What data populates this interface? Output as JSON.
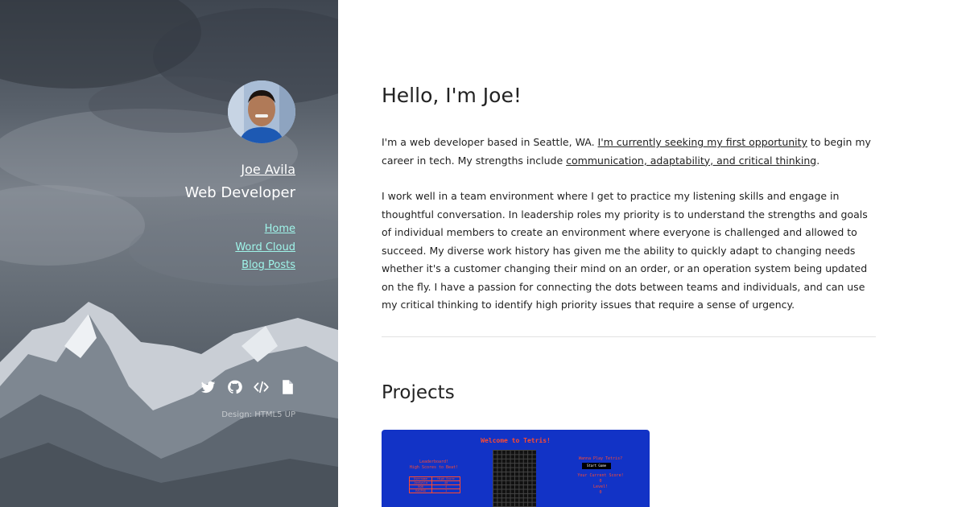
{
  "sidebar": {
    "name": "Joe Avila",
    "role": "Web Developer",
    "nav": [
      {
        "label": "Home"
      },
      {
        "label": "Word Cloud"
      },
      {
        "label": "Blog Posts"
      }
    ],
    "social": [
      {
        "icon": "twitter-icon"
      },
      {
        "icon": "github-icon"
      },
      {
        "icon": "code-icon"
      },
      {
        "icon": "document-icon"
      }
    ],
    "credit": "Design: HTML5 UP",
    "accent": "#9ff5ea"
  },
  "main": {
    "greeting": "Hello, I'm Joe!",
    "intro": {
      "text1": "I'm a web developer based in Seattle, WA. ",
      "link1": "I'm currently seeking my first opportunity",
      "text2": " to begin my career in tech. My strengths include ",
      "link2": "communication, adaptability, and critical thinking",
      "text3": "."
    },
    "bio": "I work well in a team environment where I get to practice my listening skills and engage in thoughtful conversation. In leadership roles my priority is to understand the strengths and goals of individual members to create an environment where everyone is challenged and allowed to succeed. My diverse work history has given me the ability to quickly adapt to changing needs whether it's a customer changing their mind on an order, or an operation system being updated on the fly. I have a passion for connecting the dots between teams and individuals, and can use my critical thinking to identify high priority issues that require a sense of urgency.",
    "projects_heading": "Projects",
    "project": {
      "title": "Welcome to Tetris!",
      "leaderboard_title": "Leaderboard!",
      "leaderboard_subtitle": "High Scores to Beat!",
      "leaderboard_headers": [
        "Username",
        "High Score"
      ],
      "leaderboard_rows": [
        [
          "JoeAvila",
          "40"
        ],
        [
          "BOB",
          "4"
        ],
        [
          "RAGPUG",
          "1"
        ]
      ],
      "wanna_play": "Wanna Play Tetris?",
      "start_label": "Start Game",
      "score_label": "Your Current Score!",
      "score_value": "0",
      "level_label": "Level!",
      "level_value": "0"
    }
  }
}
